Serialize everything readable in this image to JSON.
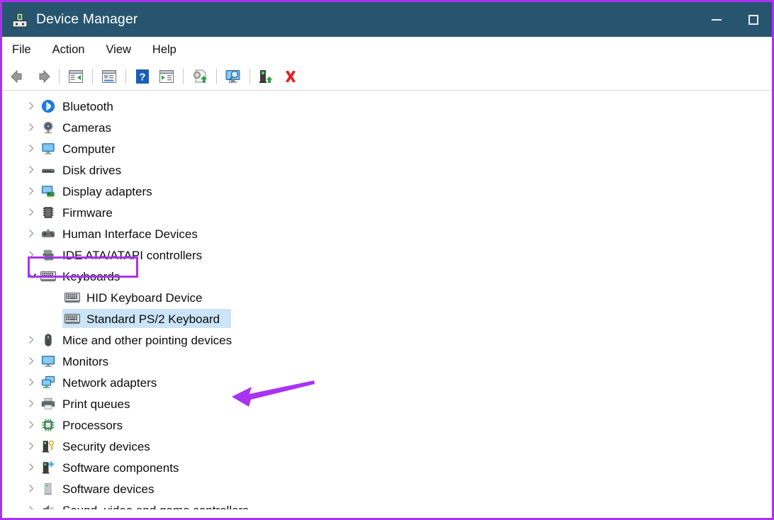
{
  "window": {
    "title": "Device Manager",
    "app_icon": "device-manager-icon",
    "title_bar_color": "#27556f",
    "annotation_color": "#a933f0",
    "selection_color": "#cce4f7",
    "controls": [
      {
        "name": "minimize",
        "glyph": "minimize-icon"
      },
      {
        "name": "maximize",
        "glyph": "maximize-icon"
      }
    ]
  },
  "menu": {
    "items": [
      {
        "label": "File"
      },
      {
        "label": "Action"
      },
      {
        "label": "View"
      },
      {
        "label": "Help"
      }
    ]
  },
  "toolbar": {
    "buttons": [
      {
        "name": "back-button",
        "icon": "back-arrow-icon"
      },
      {
        "name": "forward-button",
        "icon": "forward-arrow-icon"
      },
      {
        "name": "separator-1",
        "icon": "separator"
      },
      {
        "name": "show-hide-console-tree-button",
        "icon": "console-tree-icon"
      },
      {
        "name": "separator-2",
        "icon": "separator"
      },
      {
        "name": "properties-button",
        "icon": "properties-icon"
      },
      {
        "name": "separator-3",
        "icon": "separator"
      },
      {
        "name": "help-button",
        "icon": "help-question-icon"
      },
      {
        "name": "show-hide-action-pane-button",
        "icon": "action-pane-icon"
      },
      {
        "name": "separator-4",
        "icon": "separator"
      },
      {
        "name": "update-driver-button",
        "icon": "update-driver-icon"
      },
      {
        "name": "separator-5",
        "icon": "separator"
      },
      {
        "name": "scan-for-hardware-changes-button",
        "icon": "scan-hardware-icon"
      },
      {
        "name": "separator-6",
        "icon": "separator"
      },
      {
        "name": "enable-device-button",
        "icon": "enable-device-icon"
      },
      {
        "name": "uninstall-device-button",
        "icon": "uninstall-red-x-icon"
      }
    ]
  },
  "tree": {
    "items": [
      {
        "label": "Bluetooth",
        "level": 0,
        "expander": "collapsed",
        "icon": "bluetooth-icon",
        "selected": false
      },
      {
        "label": "Cameras",
        "level": 0,
        "expander": "collapsed",
        "icon": "camera-icon",
        "selected": false
      },
      {
        "label": "Computer",
        "level": 0,
        "expander": "collapsed",
        "icon": "computer-icon",
        "selected": false
      },
      {
        "label": "Disk drives",
        "level": 0,
        "expander": "collapsed",
        "icon": "disk-drive-icon",
        "selected": false
      },
      {
        "label": "Display adapters",
        "level": 0,
        "expander": "collapsed",
        "icon": "display-adapter-icon",
        "selected": false
      },
      {
        "label": "Firmware",
        "level": 0,
        "expander": "collapsed",
        "icon": "firmware-chip-icon",
        "selected": false
      },
      {
        "label": "Human Interface Devices",
        "level": 0,
        "expander": "collapsed",
        "icon": "hid-gamepad-icon",
        "selected": false
      },
      {
        "label": "IDE ATA/ATAPI controllers",
        "level": 0,
        "expander": "collapsed",
        "icon": "ide-controller-icon",
        "selected": false
      },
      {
        "label": "Keyboards",
        "level": 0,
        "expander": "expanded",
        "icon": "keyboard-icon",
        "selected": false,
        "highlighted": true
      },
      {
        "label": "HID Keyboard Device",
        "level": 1,
        "expander": "none",
        "icon": "keyboard-icon",
        "selected": false
      },
      {
        "label": "Standard PS/2 Keyboard",
        "level": 1,
        "expander": "none",
        "icon": "keyboard-icon",
        "selected": true
      },
      {
        "label": "Mice and other pointing devices",
        "level": 0,
        "expander": "collapsed",
        "icon": "mouse-icon",
        "selected": false
      },
      {
        "label": "Monitors",
        "level": 0,
        "expander": "collapsed",
        "icon": "monitor-icon",
        "selected": false
      },
      {
        "label": "Network adapters",
        "level": 0,
        "expander": "collapsed",
        "icon": "network-adapter-icon",
        "selected": false
      },
      {
        "label": "Print queues",
        "level": 0,
        "expander": "collapsed",
        "icon": "printer-icon",
        "selected": false
      },
      {
        "label": "Processors",
        "level": 0,
        "expander": "collapsed",
        "icon": "processor-icon",
        "selected": false
      },
      {
        "label": "Security devices",
        "level": 0,
        "expander": "collapsed",
        "icon": "security-device-icon",
        "selected": false
      },
      {
        "label": "Software components",
        "level": 0,
        "expander": "collapsed",
        "icon": "software-component-icon",
        "selected": false
      },
      {
        "label": "Software devices",
        "level": 0,
        "expander": "collapsed",
        "icon": "software-device-icon",
        "selected": false
      },
      {
        "label": "Sound, video and game controllers",
        "level": 0,
        "expander": "collapsed",
        "icon": "speaker-icon",
        "selected": false
      }
    ]
  },
  "annotations": {
    "highlight_target": "Keyboards",
    "arrow_target": "Standard PS/2 Keyboard",
    "color": "#a933f0"
  }
}
